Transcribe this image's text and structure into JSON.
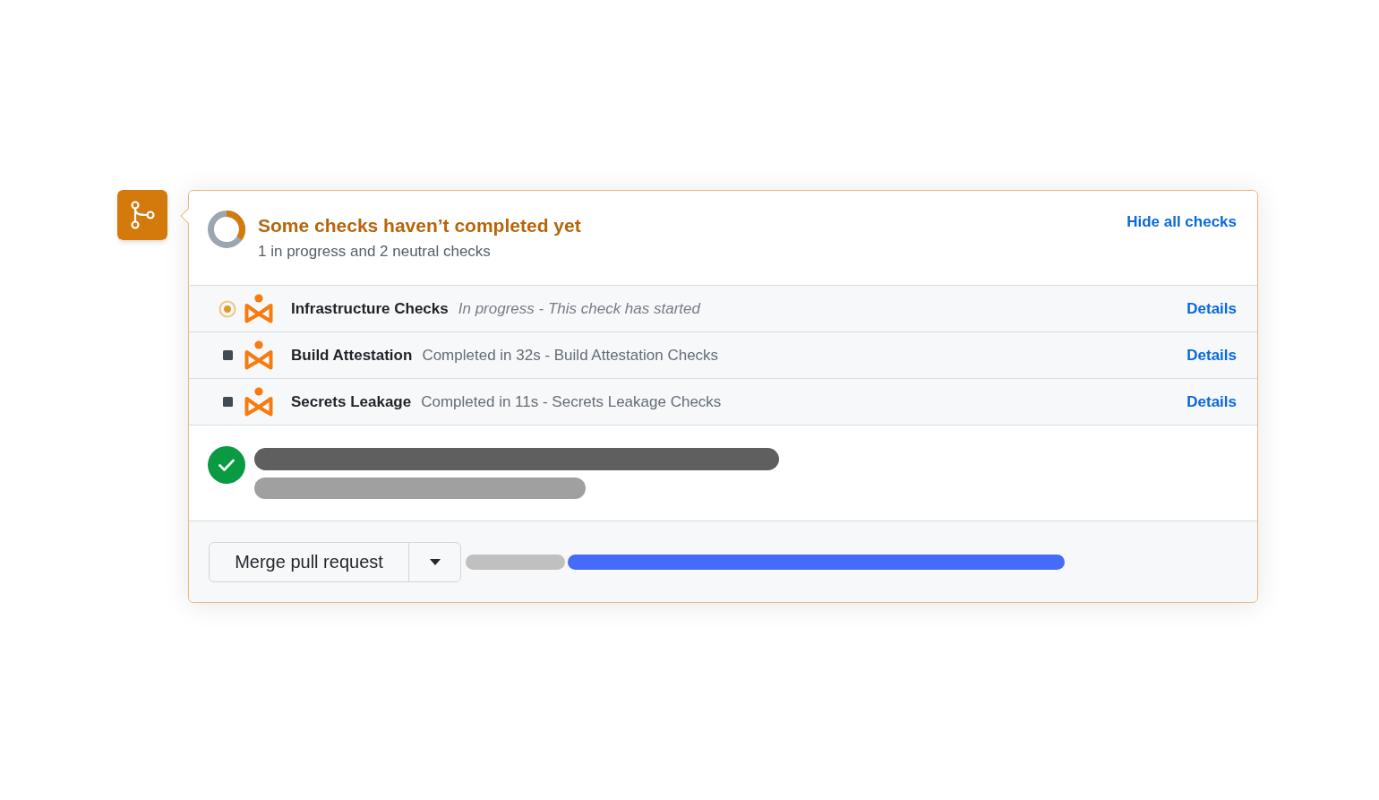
{
  "summary": {
    "title": "Some checks haven’t completed yet",
    "subtitle": "1 in progress and 2 neutral checks",
    "toggle_link": "Hide all checks"
  },
  "checks": [
    {
      "kind": "running",
      "name": "Infrastructure Checks",
      "description": "In progress - This check has started",
      "link": "Details"
    },
    {
      "kind": "neutral",
      "name": "Build Attestation",
      "description": "Completed in 32s - Build Attestation Checks",
      "link": "Details"
    },
    {
      "kind": "neutral",
      "name": "Secrets Leakage",
      "description": "Completed in 11s - Secrets Leakage Checks",
      "link": "Details"
    }
  ],
  "merge_button": {
    "label": "Merge pull request"
  }
}
